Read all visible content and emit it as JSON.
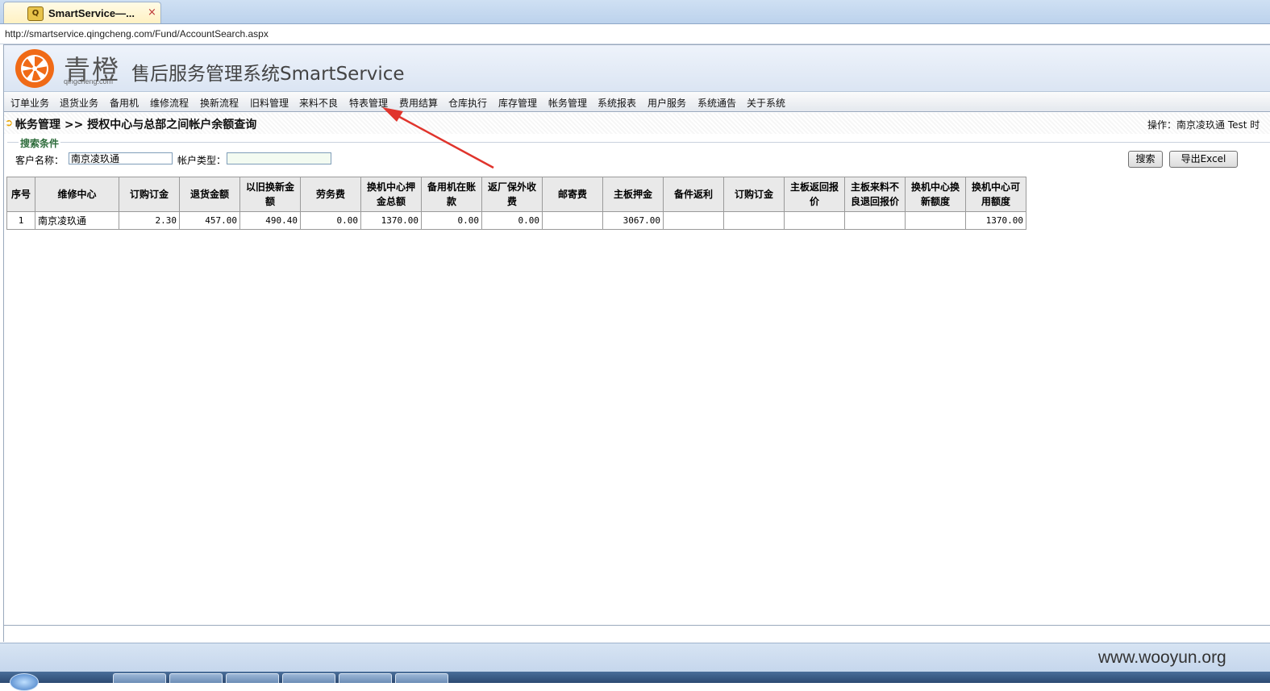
{
  "browser": {
    "tab_title": "SmartService—...",
    "tab_close": "×",
    "favicon_glyph": "Q",
    "url": "http://smartservice.qingcheng.com/Fund/AccountSearch.aspx"
  },
  "header": {
    "brand": "青橙",
    "domain": "qingcheng.com",
    "system_title": "售后服务管理系统SmartService",
    "logo_color": "#f06a16"
  },
  "nav": {
    "items": [
      "订单业务",
      "退货业务",
      "备用机",
      "维修流程",
      "换新流程",
      "旧料管理",
      "来料不良",
      "特表管理",
      "费用结算",
      "仓库执行",
      "库存管理",
      "帐务管理",
      "系统报表",
      "用户服务",
      "系统通告",
      "关于系统"
    ]
  },
  "breadcrumb": {
    "arrow": "➲",
    "text": "帐务管理 >> 授权中心与总部之间帐户余额查询",
    "operator": "操作：南京凌玖通 Test 时"
  },
  "search": {
    "legend": "搜索条件",
    "customer_label": "客户名称：",
    "customer_value": "南京凌玖通",
    "type_label": "帐户类型：",
    "type_value": "",
    "search_button": "搜索",
    "export_button": "导出Excel"
  },
  "table": {
    "headers": [
      "序号",
      "维修中心",
      "订购订金",
      "退货金额",
      "以旧换新金额",
      "劳务费",
      "换机中心押金总额",
      "备用机在账款",
      "返厂保外收费",
      "邮寄费",
      "主板押金",
      "备件返利",
      "订购订金",
      "主板返回报价",
      "主板来料不良退回报价",
      "换机中心换新额度",
      "换机中心可用额度"
    ],
    "rows": [
      [
        "1",
        "南京凌玖通",
        "2.30",
        "457.00",
        "490.40",
        "0.00",
        "1370.00",
        "0.00",
        "0.00",
        "",
        "3067.00",
        "",
        "",
        "",
        "",
        "",
        "1370.00"
      ]
    ]
  },
  "watermark": "www.wooyun.org",
  "colors": {
    "annotation_arrow": "#e0342c",
    "legend_text": "#2c6b3a",
    "breadcrumb_arrow": "#e8a400"
  }
}
